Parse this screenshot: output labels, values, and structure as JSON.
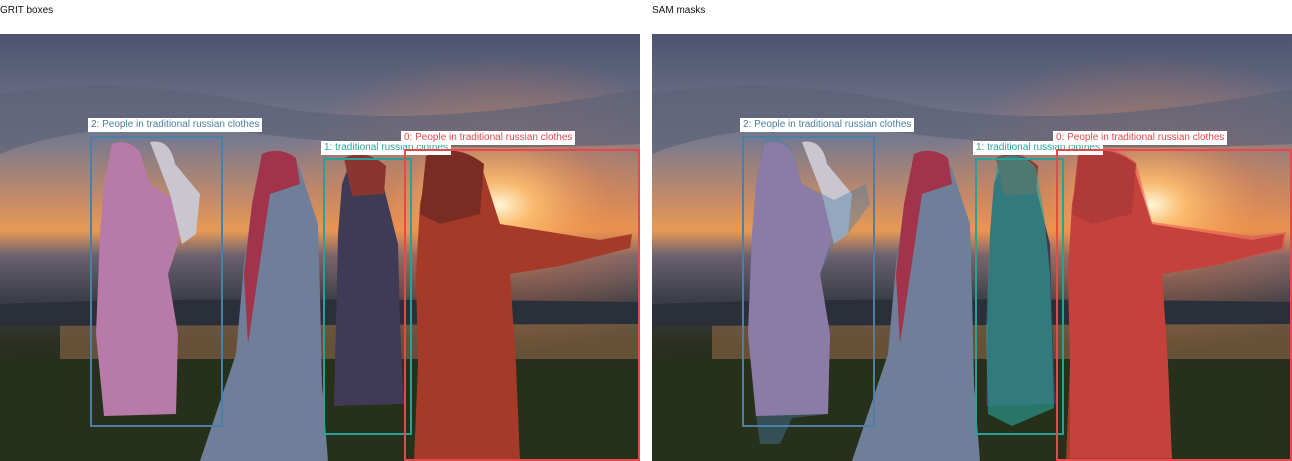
{
  "panels": [
    {
      "title": "GRIT boxes"
    },
    {
      "title": "SAM masks"
    }
  ],
  "detections": [
    {
      "label": "0: People in traditional russian clothes",
      "color": "#e5484d"
    },
    {
      "label": "1: traditional russian clothes",
      "color": "#2aa198"
    },
    {
      "label": "2: People in traditional russian clothes",
      "color": "#4a7fa6"
    }
  ]
}
